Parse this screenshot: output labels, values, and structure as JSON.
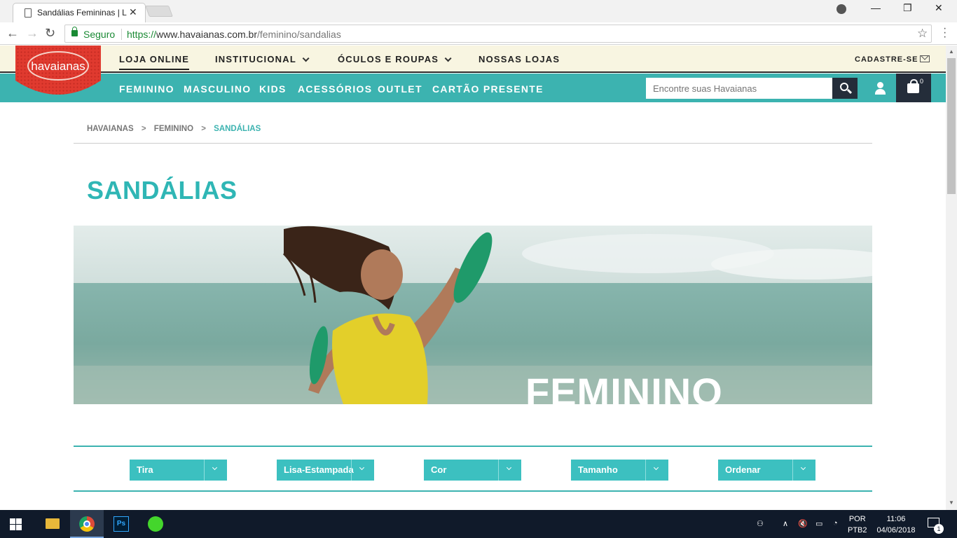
{
  "browser": {
    "tab_title": "Sandálias Femininas | Loja",
    "tab_close": "✕",
    "secure_label": "Seguro",
    "url_scheme": "https://",
    "url_host": "www.havaianas.com.br",
    "url_path": "/feminino/sandalias"
  },
  "site": {
    "logo_text": "havaianas",
    "top_nav": [
      {
        "label": "LOJA ONLINE",
        "active": true
      },
      {
        "label": "INSTITUCIONAL",
        "dropdown": true
      },
      {
        "label": "ÓCULOS E ROUPAS",
        "dropdown": true
      },
      {
        "label": "NOSSAS LOJAS"
      }
    ],
    "signup_label": "CADASTRE-SE",
    "main_nav": [
      "FEMININO",
      "MASCULINO",
      "KIDS",
      "ACESSÓRIOS",
      "OUTLET",
      "CARTÃO PRESENTE"
    ],
    "search_placeholder": "Encontre suas Havaianas",
    "cart_count": "0"
  },
  "breadcrumb": {
    "items": [
      "HAVAIANAS",
      "FEMININO",
      "SANDÁLIAS"
    ],
    "separator": ">"
  },
  "page": {
    "title": "SANDÁLIAS",
    "banner_text": "FEMININO"
  },
  "filters": [
    "Tira",
    "Lisa-Estampada",
    "Cor",
    "Tamanho",
    "Ordenar"
  ],
  "taskbar": {
    "ps_label": "Ps",
    "lang_top": "POR",
    "lang_bottom": "PTB2",
    "time": "11:06",
    "date": "04/06/2018",
    "notif_count": "1"
  },
  "colors": {
    "teal": "#3cb3b0",
    "cream": "#f8f5e1",
    "dark": "#242d3a",
    "logo_red": "#e03a2f"
  }
}
